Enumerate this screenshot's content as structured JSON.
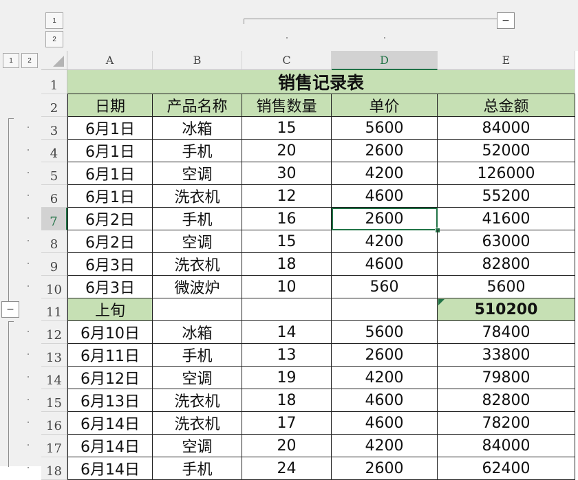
{
  "outline": {
    "col_levels": [
      "1",
      "2"
    ],
    "row_levels": [
      "1",
      "2"
    ],
    "collapse_symbol": "−"
  },
  "columns": [
    {
      "letter": "A",
      "selected": false
    },
    {
      "letter": "B",
      "selected": false
    },
    {
      "letter": "C",
      "selected": false
    },
    {
      "letter": "D",
      "selected": true
    },
    {
      "letter": "E",
      "selected": false
    }
  ],
  "selected_cell": "D7",
  "rows": [
    {
      "num": "1",
      "type": "title",
      "cells": [
        "销售记录表"
      ]
    },
    {
      "num": "2",
      "type": "header",
      "cells": [
        "日期",
        "产品名称",
        "销售数量",
        "单价",
        "总金额"
      ]
    },
    {
      "num": "3",
      "type": "data",
      "cells": [
        "6月1日",
        "冰箱",
        "15",
        "5600",
        "84000"
      ]
    },
    {
      "num": "4",
      "type": "data",
      "cells": [
        "6月1日",
        "手机",
        "20",
        "2600",
        "52000"
      ]
    },
    {
      "num": "5",
      "type": "data",
      "cells": [
        "6月1日",
        "空调",
        "30",
        "4200",
        "126000"
      ]
    },
    {
      "num": "6",
      "type": "data",
      "cells": [
        "6月1日",
        "洗衣机",
        "12",
        "4600",
        "55200"
      ]
    },
    {
      "num": "7",
      "type": "data",
      "cells": [
        "6月2日",
        "手机",
        "16",
        "2600",
        "41600"
      ]
    },
    {
      "num": "8",
      "type": "data",
      "cells": [
        "6月2日",
        "空调",
        "15",
        "4200",
        "63000"
      ]
    },
    {
      "num": "9",
      "type": "data",
      "cells": [
        "6月3日",
        "洗衣机",
        "18",
        "4600",
        "82800"
      ]
    },
    {
      "num": "10",
      "type": "data",
      "cells": [
        "6月3日",
        "微波炉",
        "10",
        "560",
        "5600"
      ]
    },
    {
      "num": "11",
      "type": "subtotal",
      "cells": [
        "上旬",
        "",
        "",
        "",
        "510200"
      ]
    },
    {
      "num": "12",
      "type": "data",
      "cells": [
        "6月10日",
        "冰箱",
        "14",
        "5600",
        "78400"
      ]
    },
    {
      "num": "13",
      "type": "data",
      "cells": [
        "6月11日",
        "手机",
        "13",
        "2600",
        "33800"
      ]
    },
    {
      "num": "14",
      "type": "data",
      "cells": [
        "6月12日",
        "空调",
        "19",
        "4200",
        "79800"
      ]
    },
    {
      "num": "15",
      "type": "data",
      "cells": [
        "6月13日",
        "洗衣机",
        "18",
        "4600",
        "82800"
      ]
    },
    {
      "num": "16",
      "type": "data",
      "cells": [
        "6月14日",
        "洗衣机",
        "17",
        "4600",
        "78200"
      ]
    },
    {
      "num": "17",
      "type": "data",
      "cells": [
        "6月14日",
        "空调",
        "20",
        "4200",
        "84000"
      ]
    },
    {
      "num": "18",
      "type": "data",
      "cells": [
        "6月14日",
        "手机",
        "24",
        "2600",
        "62400"
      ]
    }
  ],
  "colors": {
    "header_fill": "#c6e0b4",
    "selection": "#217346",
    "grid": "#d4d4d4",
    "border": "#222222"
  }
}
